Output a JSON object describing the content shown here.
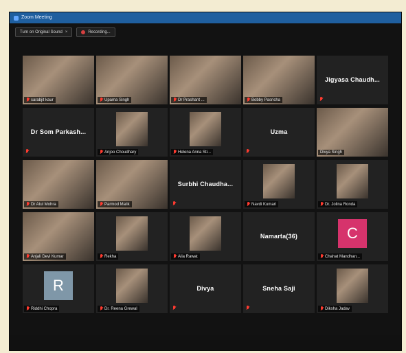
{
  "window": {
    "title": "Zoom Meeting"
  },
  "toolbar": {
    "original_sound_label": "Turn on Original Sound",
    "close_symbol": "×",
    "recording_label": "Recording..."
  },
  "participants": [
    {
      "name": "sarabjit kaur",
      "video": true
    },
    {
      "name": "Upama Singh",
      "video": true
    },
    {
      "name": "Dr Prashant ...",
      "video": true,
      "active": true
    },
    {
      "name": "Bobby Pasricha",
      "video": true
    },
    {
      "name": "Jigyasa Chaudh...",
      "video": false
    },
    {
      "name": "Dr Som Parkash...",
      "video": false
    },
    {
      "name": "Anjoo Choudhary",
      "video": true
    },
    {
      "name": "Helena Anna Sti...",
      "video": true
    },
    {
      "name": "Uzma",
      "video": false
    },
    {
      "name": "Divya Singh",
      "video": true
    },
    {
      "name": "Dr Atul Mohra",
      "video": true
    },
    {
      "name": "Parmod Malik",
      "video": true
    },
    {
      "name": "Surbhi Chaudha...",
      "video": false
    },
    {
      "name": "Navdi Kumari",
      "video": true
    },
    {
      "name": "Dr. Jolina Ronda",
      "video": true
    },
    {
      "name": "Anjali Devi Kumar",
      "video": true
    },
    {
      "name": "Rekha",
      "video": true
    },
    {
      "name": "Alia Rawat",
      "video": true
    },
    {
      "name": "Namarta(36)",
      "video": false
    },
    {
      "name": "Chahat Mandhan...",
      "video": false,
      "letter": "C",
      "avatar_color": "#d6336c"
    },
    {
      "name": "Riddhi Chopra",
      "video": false,
      "letter": "R",
      "avatar_color": "#7f97a8"
    },
    {
      "name": "Dr. Reena Grewal",
      "video": true
    },
    {
      "name": "Divya",
      "video": false
    },
    {
      "name": "Sneha Saji",
      "video": false
    },
    {
      "name": "Diksha Jadav",
      "video": true
    }
  ],
  "colors": {
    "titlebar": "#1f5f9f",
    "active_speaker": "#9fd35a",
    "mic_muted": "#ff3b30",
    "tile_bg": "#222222"
  },
  "icons": {
    "mic": "mic-muted-icon",
    "recording": "recording-icon"
  }
}
